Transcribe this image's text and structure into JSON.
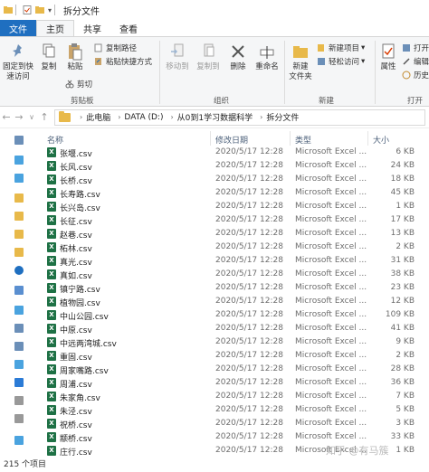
{
  "window": {
    "title": "拆分文件"
  },
  "menu": {
    "tabs": [
      "文件",
      "主页",
      "共享",
      "查看"
    ]
  },
  "ribbon": {
    "pin_label": "固定到快\n速访问",
    "copy_label": "复制",
    "paste_label": "粘贴",
    "copy_path_label": "复制路径",
    "paste_shortcut_label": "粘贴快捷方式",
    "cut_label": "剪切",
    "clipboard_group": "剪贴板",
    "move_to_label": "移动到",
    "copy_to_label": "复制到",
    "delete_label": "删除",
    "rename_label": "重命名",
    "organize_group": "组织",
    "new_folder_label": "新建\n文件夹",
    "new_item_label": "新建项目",
    "easy_access_label": "轻松访问",
    "new_group": "新建",
    "properties_label": "属性",
    "open_label": "打开",
    "edit_label": "编辑",
    "history_label": "历史",
    "open_group": "打开"
  },
  "address": {
    "crumbs": [
      "此电脑",
      "DATA (D:)",
      "从0到1学习数据科学",
      "拆分文件"
    ]
  },
  "columns": {
    "name": "名称",
    "date": "修改日期",
    "type": "类型",
    "size": "大小"
  },
  "files": [
    {
      "name": "张堰.csv",
      "date": "2020/5/17 12:28",
      "type": "Microsoft Excel ...",
      "size": "6 KB"
    },
    {
      "name": "长风.csv",
      "date": "2020/5/17 12:28",
      "type": "Microsoft Excel ...",
      "size": "24 KB"
    },
    {
      "name": "长桥.csv",
      "date": "2020/5/17 12:28",
      "type": "Microsoft Excel ...",
      "size": "18 KB"
    },
    {
      "name": "长寿路.csv",
      "date": "2020/5/17 12:28",
      "type": "Microsoft Excel ...",
      "size": "45 KB"
    },
    {
      "name": "长兴岛.csv",
      "date": "2020/5/17 12:28",
      "type": "Microsoft Excel ...",
      "size": "1 KB"
    },
    {
      "name": "长征.csv",
      "date": "2020/5/17 12:28",
      "type": "Microsoft Excel ...",
      "size": "17 KB"
    },
    {
      "name": "赵巷.csv",
      "date": "2020/5/17 12:28",
      "type": "Microsoft Excel ...",
      "size": "13 KB"
    },
    {
      "name": "柘林.csv",
      "date": "2020/5/17 12:28",
      "type": "Microsoft Excel ...",
      "size": "2 KB"
    },
    {
      "name": "真光.csv",
      "date": "2020/5/17 12:28",
      "type": "Microsoft Excel ...",
      "size": "31 KB"
    },
    {
      "name": "真如.csv",
      "date": "2020/5/17 12:28",
      "type": "Microsoft Excel ...",
      "size": "38 KB"
    },
    {
      "name": "镇宁路.csv",
      "date": "2020/5/17 12:28",
      "type": "Microsoft Excel ...",
      "size": "23 KB"
    },
    {
      "name": "植物园.csv",
      "date": "2020/5/17 12:28",
      "type": "Microsoft Excel ...",
      "size": "12 KB"
    },
    {
      "name": "中山公园.csv",
      "date": "2020/5/17 12:28",
      "type": "Microsoft Excel ...",
      "size": "109 KB"
    },
    {
      "name": "中原.csv",
      "date": "2020/5/17 12:28",
      "type": "Microsoft Excel ...",
      "size": "41 KB"
    },
    {
      "name": "中远两湾城.csv",
      "date": "2020/5/17 12:28",
      "type": "Microsoft Excel ...",
      "size": "9 KB"
    },
    {
      "name": "重固.csv",
      "date": "2020/5/17 12:28",
      "type": "Microsoft Excel ...",
      "size": "2 KB"
    },
    {
      "name": "周家嘴路.csv",
      "date": "2020/5/17 12:28",
      "type": "Microsoft Excel ...",
      "size": "28 KB"
    },
    {
      "name": "周浦.csv",
      "date": "2020/5/17 12:28",
      "type": "Microsoft Excel ...",
      "size": "36 KB"
    },
    {
      "name": "朱家角.csv",
      "date": "2020/5/17 12:28",
      "type": "Microsoft Excel ...",
      "size": "7 KB"
    },
    {
      "name": "朱泾.csv",
      "date": "2020/5/17 12:28",
      "type": "Microsoft Excel ...",
      "size": "5 KB"
    },
    {
      "name": "祝桥.csv",
      "date": "2020/5/17 12:28",
      "type": "Microsoft Excel ...",
      "size": "3 KB"
    },
    {
      "name": "颛桥.csv",
      "date": "2020/5/17 12:28",
      "type": "Microsoft Excel ...",
      "size": "33 KB"
    },
    {
      "name": "庄行.csv",
      "date": "2020/5/17 12:28",
      "type": "Microsoft Excel ...",
      "size": "1 KB"
    }
  ],
  "status": {
    "count_text": "215 个项目"
  },
  "watermark": "知乎 @有马簇",
  "colors": {
    "file_tab": "#1f6fc0",
    "excel_green": "#1e7145",
    "folder_yellow": "#e8b94a",
    "header_text": "#4c607a"
  }
}
